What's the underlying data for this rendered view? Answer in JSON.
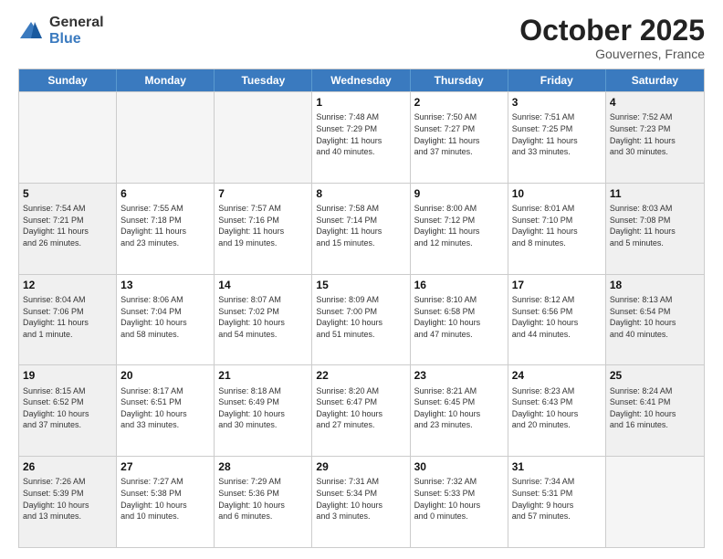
{
  "logo": {
    "general": "General",
    "blue": "Blue"
  },
  "header": {
    "month": "October 2025",
    "location": "Gouvernes, France"
  },
  "weekdays": [
    "Sunday",
    "Monday",
    "Tuesday",
    "Wednesday",
    "Thursday",
    "Friday",
    "Saturday"
  ],
  "rows": [
    [
      {
        "day": "",
        "text": "",
        "empty": true
      },
      {
        "day": "",
        "text": "",
        "empty": true
      },
      {
        "day": "",
        "text": "",
        "empty": true
      },
      {
        "day": "1",
        "text": "Sunrise: 7:48 AM\nSunset: 7:29 PM\nDaylight: 11 hours\nand 40 minutes."
      },
      {
        "day": "2",
        "text": "Sunrise: 7:50 AM\nSunset: 7:27 PM\nDaylight: 11 hours\nand 37 minutes."
      },
      {
        "day": "3",
        "text": "Sunrise: 7:51 AM\nSunset: 7:25 PM\nDaylight: 11 hours\nand 33 minutes."
      },
      {
        "day": "4",
        "text": "Sunrise: 7:52 AM\nSunset: 7:23 PM\nDaylight: 11 hours\nand 30 minutes.",
        "shaded": true
      }
    ],
    [
      {
        "day": "5",
        "text": "Sunrise: 7:54 AM\nSunset: 7:21 PM\nDaylight: 11 hours\nand 26 minutes.",
        "shaded": true
      },
      {
        "day": "6",
        "text": "Sunrise: 7:55 AM\nSunset: 7:18 PM\nDaylight: 11 hours\nand 23 minutes."
      },
      {
        "day": "7",
        "text": "Sunrise: 7:57 AM\nSunset: 7:16 PM\nDaylight: 11 hours\nand 19 minutes."
      },
      {
        "day": "8",
        "text": "Sunrise: 7:58 AM\nSunset: 7:14 PM\nDaylight: 11 hours\nand 15 minutes."
      },
      {
        "day": "9",
        "text": "Sunrise: 8:00 AM\nSunset: 7:12 PM\nDaylight: 11 hours\nand 12 minutes."
      },
      {
        "day": "10",
        "text": "Sunrise: 8:01 AM\nSunset: 7:10 PM\nDaylight: 11 hours\nand 8 minutes."
      },
      {
        "day": "11",
        "text": "Sunrise: 8:03 AM\nSunset: 7:08 PM\nDaylight: 11 hours\nand 5 minutes.",
        "shaded": true
      }
    ],
    [
      {
        "day": "12",
        "text": "Sunrise: 8:04 AM\nSunset: 7:06 PM\nDaylight: 11 hours\nand 1 minute.",
        "shaded": true
      },
      {
        "day": "13",
        "text": "Sunrise: 8:06 AM\nSunset: 7:04 PM\nDaylight: 10 hours\nand 58 minutes."
      },
      {
        "day": "14",
        "text": "Sunrise: 8:07 AM\nSunset: 7:02 PM\nDaylight: 10 hours\nand 54 minutes."
      },
      {
        "day": "15",
        "text": "Sunrise: 8:09 AM\nSunset: 7:00 PM\nDaylight: 10 hours\nand 51 minutes."
      },
      {
        "day": "16",
        "text": "Sunrise: 8:10 AM\nSunset: 6:58 PM\nDaylight: 10 hours\nand 47 minutes."
      },
      {
        "day": "17",
        "text": "Sunrise: 8:12 AM\nSunset: 6:56 PM\nDaylight: 10 hours\nand 44 minutes."
      },
      {
        "day": "18",
        "text": "Sunrise: 8:13 AM\nSunset: 6:54 PM\nDaylight: 10 hours\nand 40 minutes.",
        "shaded": true
      }
    ],
    [
      {
        "day": "19",
        "text": "Sunrise: 8:15 AM\nSunset: 6:52 PM\nDaylight: 10 hours\nand 37 minutes.",
        "shaded": true
      },
      {
        "day": "20",
        "text": "Sunrise: 8:17 AM\nSunset: 6:51 PM\nDaylight: 10 hours\nand 33 minutes."
      },
      {
        "day": "21",
        "text": "Sunrise: 8:18 AM\nSunset: 6:49 PM\nDaylight: 10 hours\nand 30 minutes."
      },
      {
        "day": "22",
        "text": "Sunrise: 8:20 AM\nSunset: 6:47 PM\nDaylight: 10 hours\nand 27 minutes."
      },
      {
        "day": "23",
        "text": "Sunrise: 8:21 AM\nSunset: 6:45 PM\nDaylight: 10 hours\nand 23 minutes."
      },
      {
        "day": "24",
        "text": "Sunrise: 8:23 AM\nSunset: 6:43 PM\nDaylight: 10 hours\nand 20 minutes."
      },
      {
        "day": "25",
        "text": "Sunrise: 8:24 AM\nSunset: 6:41 PM\nDaylight: 10 hours\nand 16 minutes.",
        "shaded": true
      }
    ],
    [
      {
        "day": "26",
        "text": "Sunrise: 7:26 AM\nSunset: 5:39 PM\nDaylight: 10 hours\nand 13 minutes.",
        "shaded": true
      },
      {
        "day": "27",
        "text": "Sunrise: 7:27 AM\nSunset: 5:38 PM\nDaylight: 10 hours\nand 10 minutes."
      },
      {
        "day": "28",
        "text": "Sunrise: 7:29 AM\nSunset: 5:36 PM\nDaylight: 10 hours\nand 6 minutes."
      },
      {
        "day": "29",
        "text": "Sunrise: 7:31 AM\nSunset: 5:34 PM\nDaylight: 10 hours\nand 3 minutes."
      },
      {
        "day": "30",
        "text": "Sunrise: 7:32 AM\nSunset: 5:33 PM\nDaylight: 10 hours\nand 0 minutes."
      },
      {
        "day": "31",
        "text": "Sunrise: 7:34 AM\nSunset: 5:31 PM\nDaylight: 9 hours\nand 57 minutes."
      },
      {
        "day": "",
        "text": "",
        "empty": true
      }
    ]
  ]
}
